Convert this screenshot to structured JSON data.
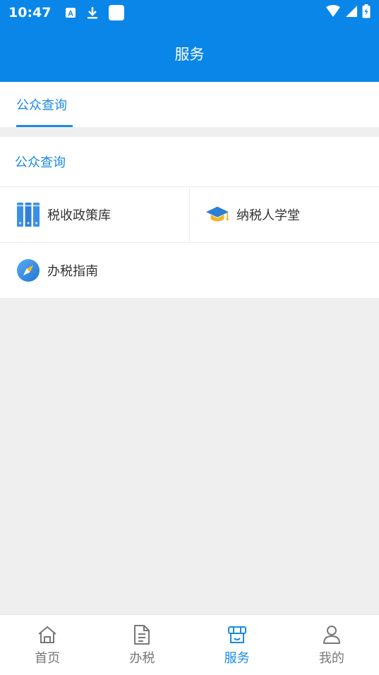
{
  "status_bar": {
    "time": "10:47",
    "icons": [
      "a-notification-icon",
      "download-icon",
      "app-icon",
      "wifi-icon",
      "signal-icon",
      "battery-icon"
    ]
  },
  "app_bar": {
    "title": "服务"
  },
  "tabs": [
    {
      "label": "公众查询",
      "active": true
    }
  ],
  "section": {
    "title": "公众查询",
    "items": [
      {
        "label": "税收政策库",
        "icon": "books-icon"
      },
      {
        "label": "纳税人学堂",
        "icon": "graduation-cap-icon"
      },
      {
        "label": "办税指南",
        "icon": "compass-icon"
      }
    ]
  },
  "bottom_nav": [
    {
      "label": "首页",
      "icon": "home-icon",
      "active": false
    },
    {
      "label": "办税",
      "icon": "document-icon",
      "active": false
    },
    {
      "label": "服务",
      "icon": "service-icon",
      "active": true
    },
    {
      "label": "我的",
      "icon": "profile-icon",
      "active": false
    }
  ],
  "colors": {
    "primary": "#0a86e8",
    "accent": "#1a8ae5",
    "background": "#efefef"
  }
}
